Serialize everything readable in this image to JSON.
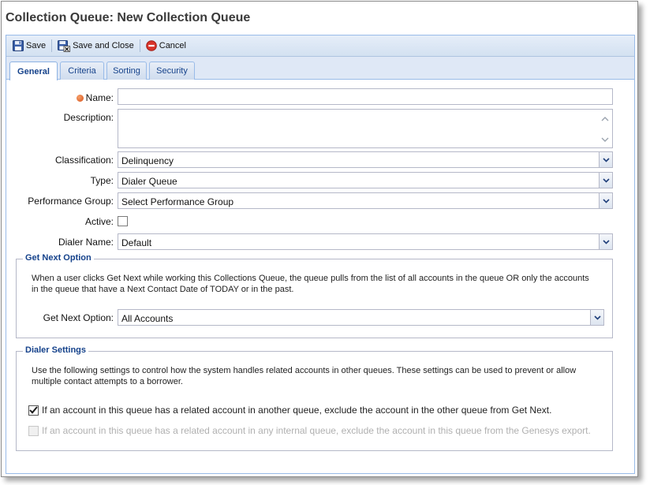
{
  "window": {
    "title": "Collection Queue: New Collection Queue"
  },
  "toolbar": {
    "save_label": "Save",
    "save_close_label": "Save and Close",
    "cancel_label": "Cancel"
  },
  "tabs": [
    {
      "label": "General",
      "active": true
    },
    {
      "label": "Criteria"
    },
    {
      "label": "Sorting"
    },
    {
      "label": "Security"
    }
  ],
  "form": {
    "name_label": "Name:",
    "name_value": "",
    "description_label": "Description:",
    "description_value": "",
    "classification_label": "Classification:",
    "classification_value": "Delinquency",
    "type_label": "Type:",
    "type_value": "Dialer Queue",
    "performance_group_label": "Performance Group:",
    "performance_group_value": "Select Performance Group",
    "active_label": "Active:",
    "active_checked": false,
    "dialer_name_label": "Dialer Name:",
    "dialer_name_value": "Default"
  },
  "get_next": {
    "legend": "Get Next Option",
    "description_line1": "When a user clicks Get Next while working this Collections Queue, the queue pulls from the list of all accounts in the queue OR only the accounts",
    "description_line2": "in the queue that have a Next Contact Date of TODAY or in the past.",
    "option_label": "Get Next Option:",
    "option_value": "All Accounts"
  },
  "dialer_settings": {
    "legend": "Dialer Settings",
    "description_line1": "Use the following settings to control how the system handles related accounts in other queues. These settings can be used to prevent or allow",
    "description_line2": "multiple contact attempts to a borrower.",
    "option1_label": "If an account in this queue has a related account in another queue, exclude the account in the other queue from Get Next.",
    "option1_checked": true,
    "option2_label": "If an account in this queue has a related account in any internal queue, exclude the account in this queue from the Genesys export.",
    "option2_checked": false,
    "option2_disabled": true
  },
  "colors": {
    "accent": "#15428b",
    "tab_bar": "#dfe8f6",
    "toolbar": "#d3e1f1",
    "required_dot": "#e06a2a"
  }
}
